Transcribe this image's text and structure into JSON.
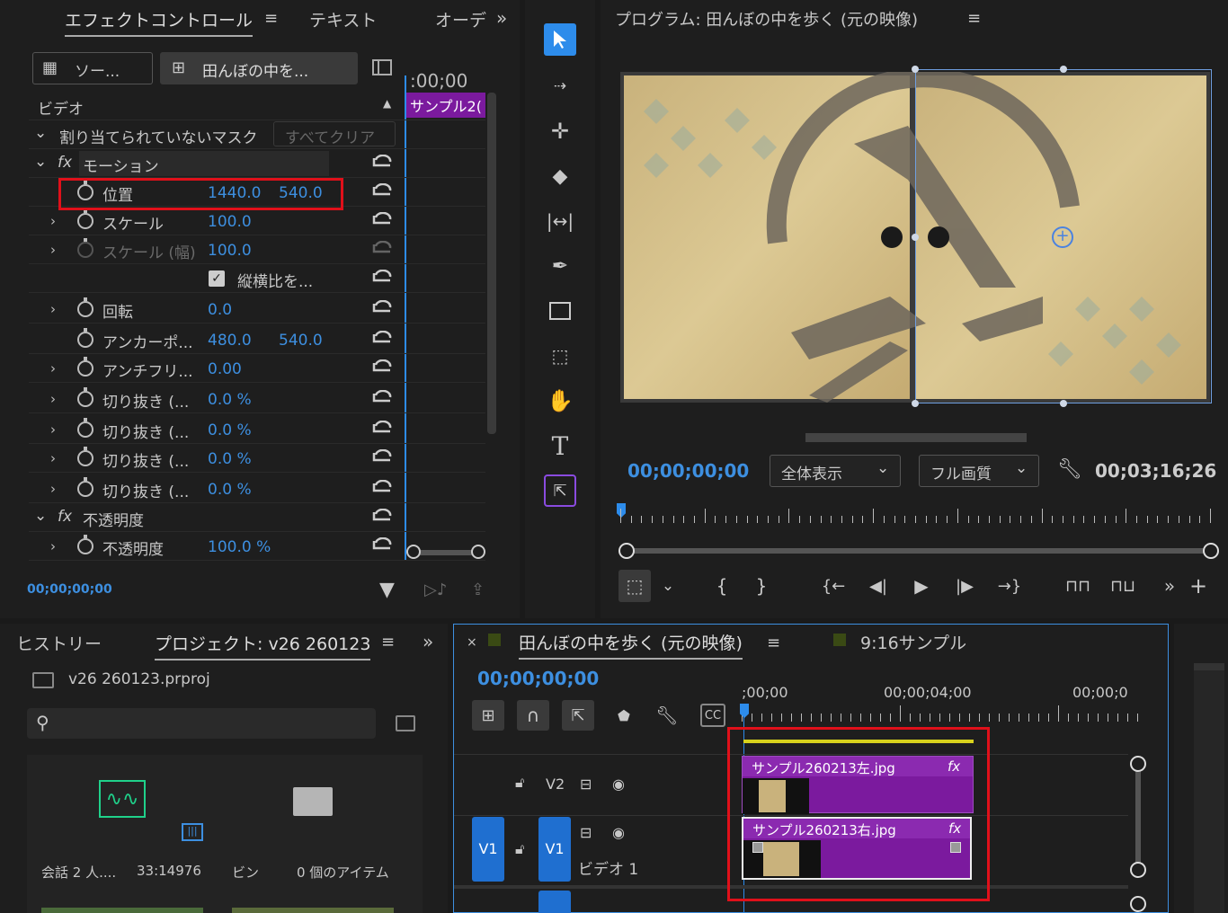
{
  "effect_controls": {
    "tabs": [
      "エフェクトコントロール",
      "テキスト",
      "オーデ"
    ],
    "source_btn": "ソー...",
    "clip_btn": "田んぼの中を...",
    "timecode_header": ":00;00",
    "clip_strip": "サンプル2(",
    "section_video": "ビデオ",
    "mask_label": "割り当てられていないマスク",
    "clear_all": "すべてクリア",
    "motion": "モーション",
    "position_label": "位置",
    "position_x": "1440.0",
    "position_y": "540.0",
    "scale_label": "スケール",
    "scale_val": "100.0",
    "scale_width_label": "スケール (幅)",
    "scale_width_val": "100.0",
    "uniform_scale": "縦横比を...",
    "rotation_label": "回転",
    "rotation_val": "0.0",
    "anchor_label": "アンカーポ...",
    "anchor_x": "480.0",
    "anchor_y": "540.0",
    "antiflicker_label": "アンチフリ...",
    "antiflicker_val": "0.00",
    "crop1_label": "切り抜き (...",
    "crop1_val": "0.0 %",
    "crop2_label": "切り抜き (...",
    "crop2_val": "0.0 %",
    "crop3_label": "切り抜き (...",
    "crop3_val": "0.0 %",
    "crop4_label": "切り抜き (...",
    "crop4_val": "0.0 %",
    "opacity_section": "不透明度",
    "opacity_label": "不透明度",
    "opacity_val": "100.0 %",
    "footer_timecode": "00;00;00;00"
  },
  "program": {
    "title": "プログラム: 田んぼの中を歩く (元の映像)",
    "timecode": "00;00;00;00",
    "zoom": "全体表示",
    "quality": "フル画質",
    "duration": "00;03;16;26"
  },
  "project": {
    "tab_history": "ヒストリー",
    "tab_project": "プロジェクト: v26 260123",
    "file": "v26 260123.prproj",
    "item1_name": "会話 2 人....",
    "item1_duration": "33:14976",
    "item2_name": "ビン",
    "item2_count": "0 個のアイテム"
  },
  "timeline": {
    "seq_tab": "田んぼの中を歩く (元の映像)",
    "seq_tab2": "9:16サンプル",
    "timecode": "00;00;00;00",
    "ruler": [
      ";00;00",
      "00;00;04;00",
      "00;00;0"
    ],
    "v2_label": "V2",
    "v1_label": "V1",
    "v1_src": "V1",
    "track_name": "ビデオ 1",
    "clip_v2": "サンプル260213左.jpg",
    "clip_v1": "サンプル260213右.jpg",
    "fx": "fx"
  },
  "colors": {
    "accent_blue": "#2d8ceb",
    "clip_purple": "#7b1a9e",
    "highlight_red": "#e0101a"
  }
}
